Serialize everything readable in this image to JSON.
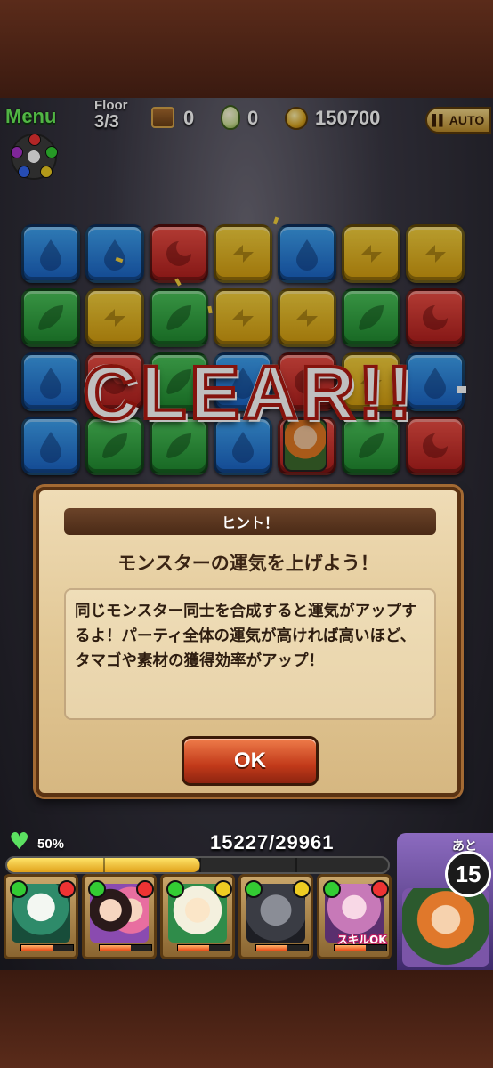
{
  "hud": {
    "menu_label": "Menu",
    "floor_label": "Floor",
    "floor_value": "3/3",
    "chest_count": "0",
    "egg_count": "0",
    "coin_count": "150700",
    "auto_label": "AUTO"
  },
  "board": {
    "rows": [
      [
        "blue",
        "blue",
        "red",
        "yellow",
        "blue",
        "yellow",
        "yellow"
      ],
      [
        "green",
        "yellow",
        "green",
        "yellow",
        "yellow",
        "green",
        "red"
      ],
      [
        "blue",
        "red",
        "green",
        "blue",
        "red",
        "yellow",
        "blue"
      ],
      [
        "blue",
        "green",
        "green",
        "blue",
        "red",
        "green",
        "red"
      ]
    ]
  },
  "clear_text": "CLEAR!!",
  "dialog": {
    "header": "ヒント！",
    "title": "モンスターの運気を上げよう！",
    "body": "同じモンスター同士を合成すると運気がアップするよ！パーティ全体の運気が高ければ高いほど、タマゴや素材の獲得効率がアップ！",
    "ok_label": "OK"
  },
  "status": {
    "luck_percent": "50%",
    "hp_text": "15227/29961",
    "hp_fraction": 0.508,
    "turns_label": "あと",
    "turns_left": "15"
  },
  "party": {
    "skill_ok_label": "スキルOK"
  },
  "colors": {
    "blue": "#1a62c4",
    "red": "#b01e1c",
    "yellow": "#d39c0e",
    "green": "#1f8a2f",
    "menu_green": "#6cf25b"
  }
}
